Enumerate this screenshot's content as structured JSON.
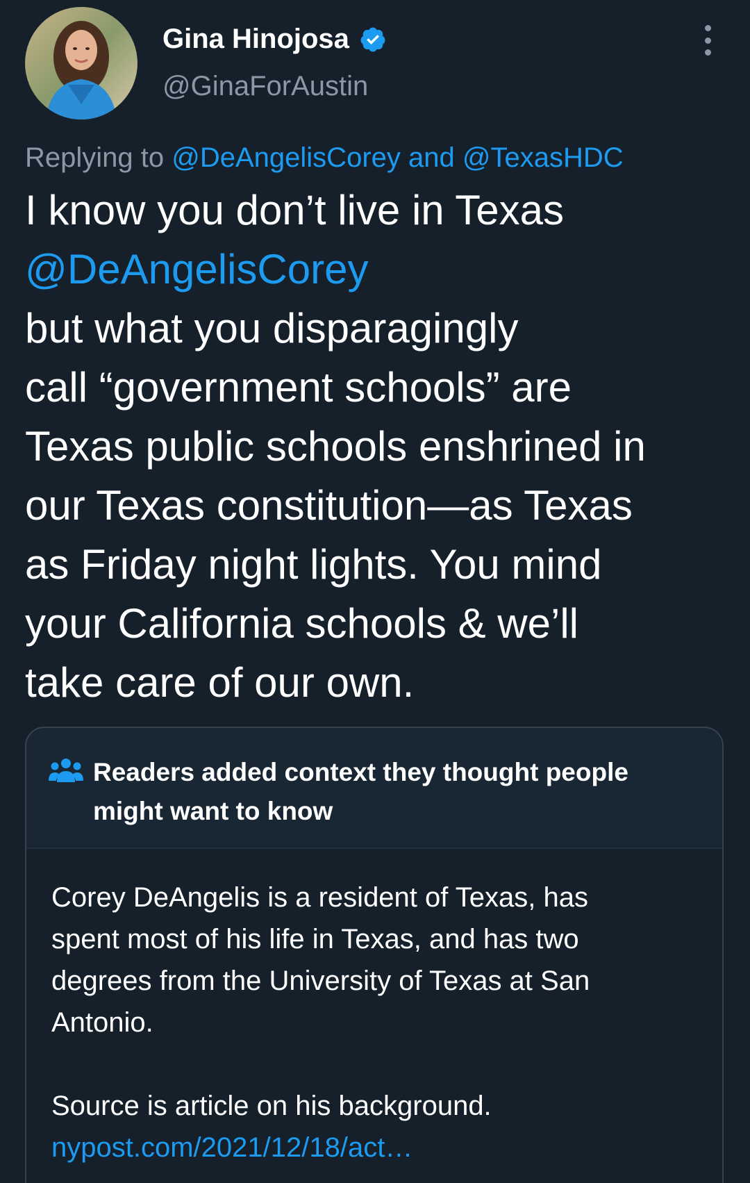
{
  "author": {
    "name": "Gina Hinojosa",
    "handle": "@GinaForAustin",
    "verified": true
  },
  "reply": {
    "prefix": "Replying to",
    "mention1": "@DeAngelisCorey",
    "conjunction": "and",
    "mention2": "@TexasHDC"
  },
  "tweet": {
    "line1": "I know you don’t live in Texas",
    "mention": "@DeAngelisCorey",
    "line3": "but what you disparagingly",
    "line4": "call “government schools” are",
    "line5": "Texas public schools enshrined in",
    "line6": "our Texas constitution—as Texas",
    "line7": "as Friday night lights. You mind",
    "line8": "your California schools & we’ll",
    "line9": "take care of our own."
  },
  "context": {
    "title_line1": "Readers added context they thought people",
    "title_line2": "might want to know",
    "body_line1": "Corey DeAngelis is a resident of Texas, has",
    "body_line2": "spent most of his life in Texas, and has two",
    "body_line3": "degrees from the University of Texas at San",
    "body_line4": "Antonio.",
    "source_text": "Source is article on his background.",
    "source_link": "nypost.com/2021/12/18/act…"
  },
  "colors": {
    "background": "#15202b",
    "accent": "#1d9bf0",
    "muted": "#8b98a5"
  },
  "icons": {
    "verified": "verified-badge-icon",
    "more": "more-options-icon",
    "context": "people-icon"
  }
}
